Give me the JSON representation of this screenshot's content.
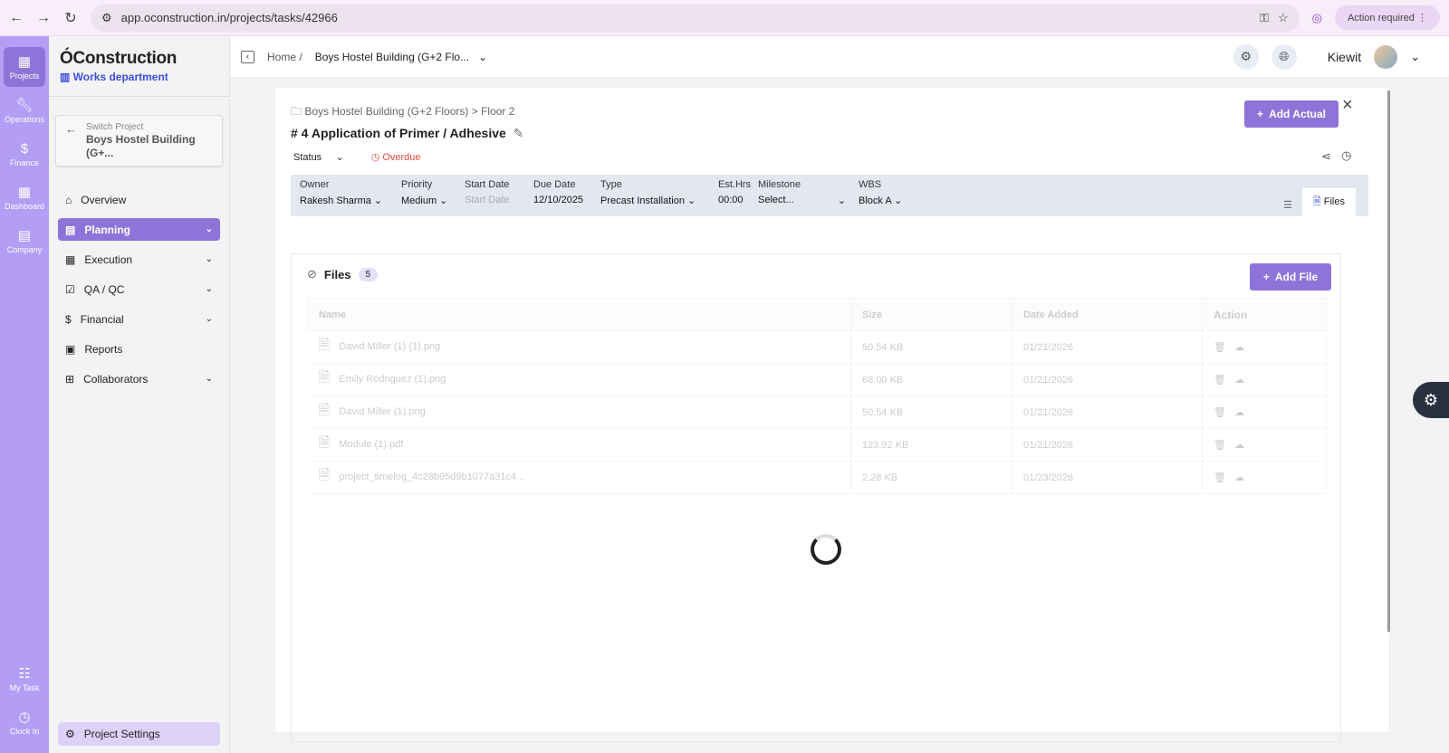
{
  "browser": {
    "url": "app.oconstruction.in/projects/tasks/42966",
    "action_required": "Action required"
  },
  "rail": [
    {
      "label": "Projects",
      "icon": "building-icon"
    },
    {
      "label": "Operations",
      "icon": "wrench-icon"
    },
    {
      "label": "Finance",
      "icon": "dollar-icon"
    },
    {
      "label": "Dashboard",
      "icon": "grid-icon"
    },
    {
      "label": "Company",
      "icon": "company-icon"
    }
  ],
  "rail_bottom": [
    {
      "label": "My Task"
    },
    {
      "label": "Clock In"
    }
  ],
  "sidebar": {
    "logo": "ÓConstruction",
    "department": "Works department",
    "switch_label": "Switch Project",
    "switch_project": "Boys Hostel Building (G+...",
    "items": [
      {
        "label": "Overview"
      },
      {
        "label": "Planning"
      },
      {
        "label": "Execution"
      },
      {
        "label": "QA / QC"
      },
      {
        "label": "Financial"
      },
      {
        "label": "Reports"
      },
      {
        "label": "Collaborators"
      }
    ],
    "settings": "Project Settings"
  },
  "topbar": {
    "home": "Home /",
    "project": "Boys Hostel Building (G+2 Flo...",
    "user": "Kiewit"
  },
  "task": {
    "breadcrumb": "Boys Hostel Building (G+2 Floors) > Floor 2",
    "title": "# 4 Application of Primer / Adhesive",
    "status_label": "Status",
    "overdue": "Overdue",
    "add_actual": "Add Actual",
    "fields": [
      {
        "label": "Owner",
        "value": "Rakesh Sharma"
      },
      {
        "label": "Priority",
        "value": "Medium"
      },
      {
        "label": "Start Date",
        "value": "Start Date"
      },
      {
        "label": "Due Date",
        "value": "12/10/2025"
      },
      {
        "label": "Type",
        "value": "Precast Installation"
      },
      {
        "label": "Est.Hrs",
        "value": "00:00"
      },
      {
        "label": "Milestone",
        "value": "Select..."
      },
      {
        "label": "WBS",
        "value": "Block A"
      }
    ],
    "files_tab": "Files"
  },
  "files": {
    "title": "Files",
    "count": "5",
    "add": "Add File",
    "columns": [
      "Name",
      "Size",
      "Date Added",
      "Action"
    ],
    "rows": [
      {
        "name": "David Miller (1) (1).png",
        "size": "50.54 KB",
        "date": "01/21/2026"
      },
      {
        "name": "Emily Rodriguez (1).png",
        "size": "68.00 KB",
        "date": "01/21/2026"
      },
      {
        "name": "David Miller (1).png",
        "size": "50.54 KB",
        "date": "01/21/2026"
      },
      {
        "name": "Module (1).pdf",
        "size": "123.92 KB",
        "date": "01/21/2026"
      },
      {
        "name": "project_timelog_4c28b95d9b1077a31c4...",
        "size": "2.28 KB",
        "date": "01/23/2026"
      }
    ]
  }
}
